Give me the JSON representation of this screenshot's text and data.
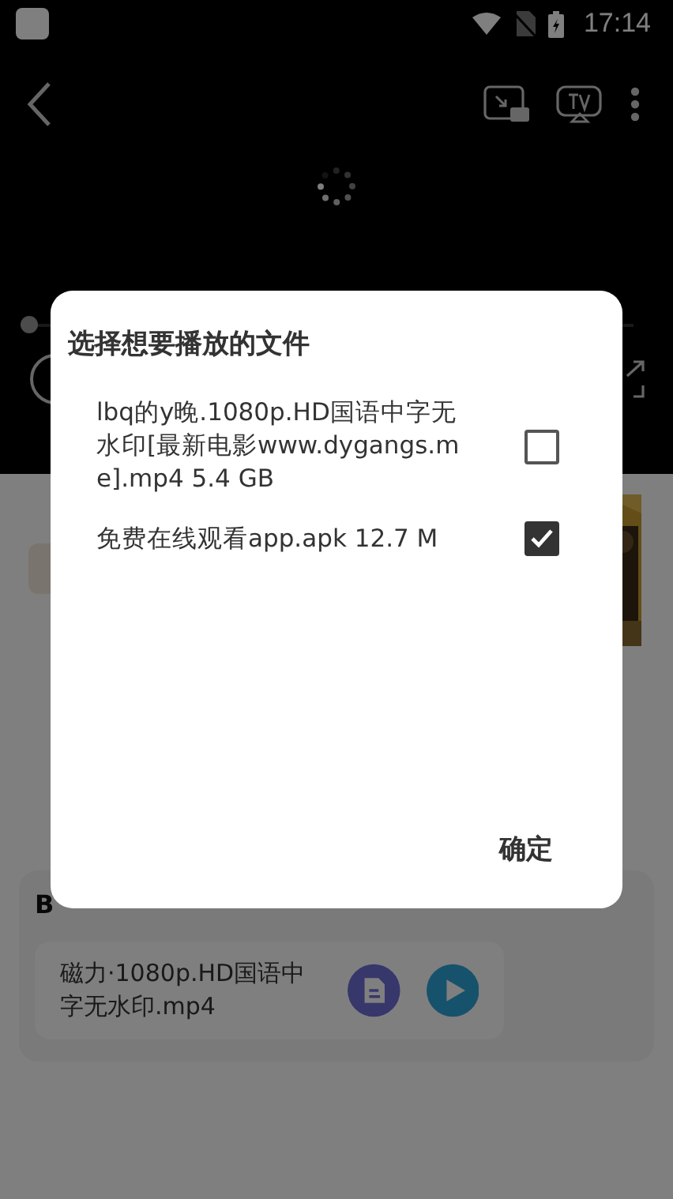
{
  "status_bar": {
    "time": "17:14"
  },
  "player": {
    "loading": true,
    "progress": {
      "level": 0
    }
  },
  "background": {
    "source_card": {
      "title": "B",
      "file": {
        "name": "磁力·1080p.HD国语中字无水印.mp4"
      }
    }
  },
  "dialog": {
    "title": "选择想要播放的文件",
    "files": [
      {
        "label": "lbq的y晚.1080p.HD国语中字无水印[最新电影www.dygangs.me].mp4 5.4 GB",
        "checked": false
      },
      {
        "label": "免费在线观看app.apk 12.7 M",
        "checked": true
      }
    ],
    "confirm": "确定"
  }
}
